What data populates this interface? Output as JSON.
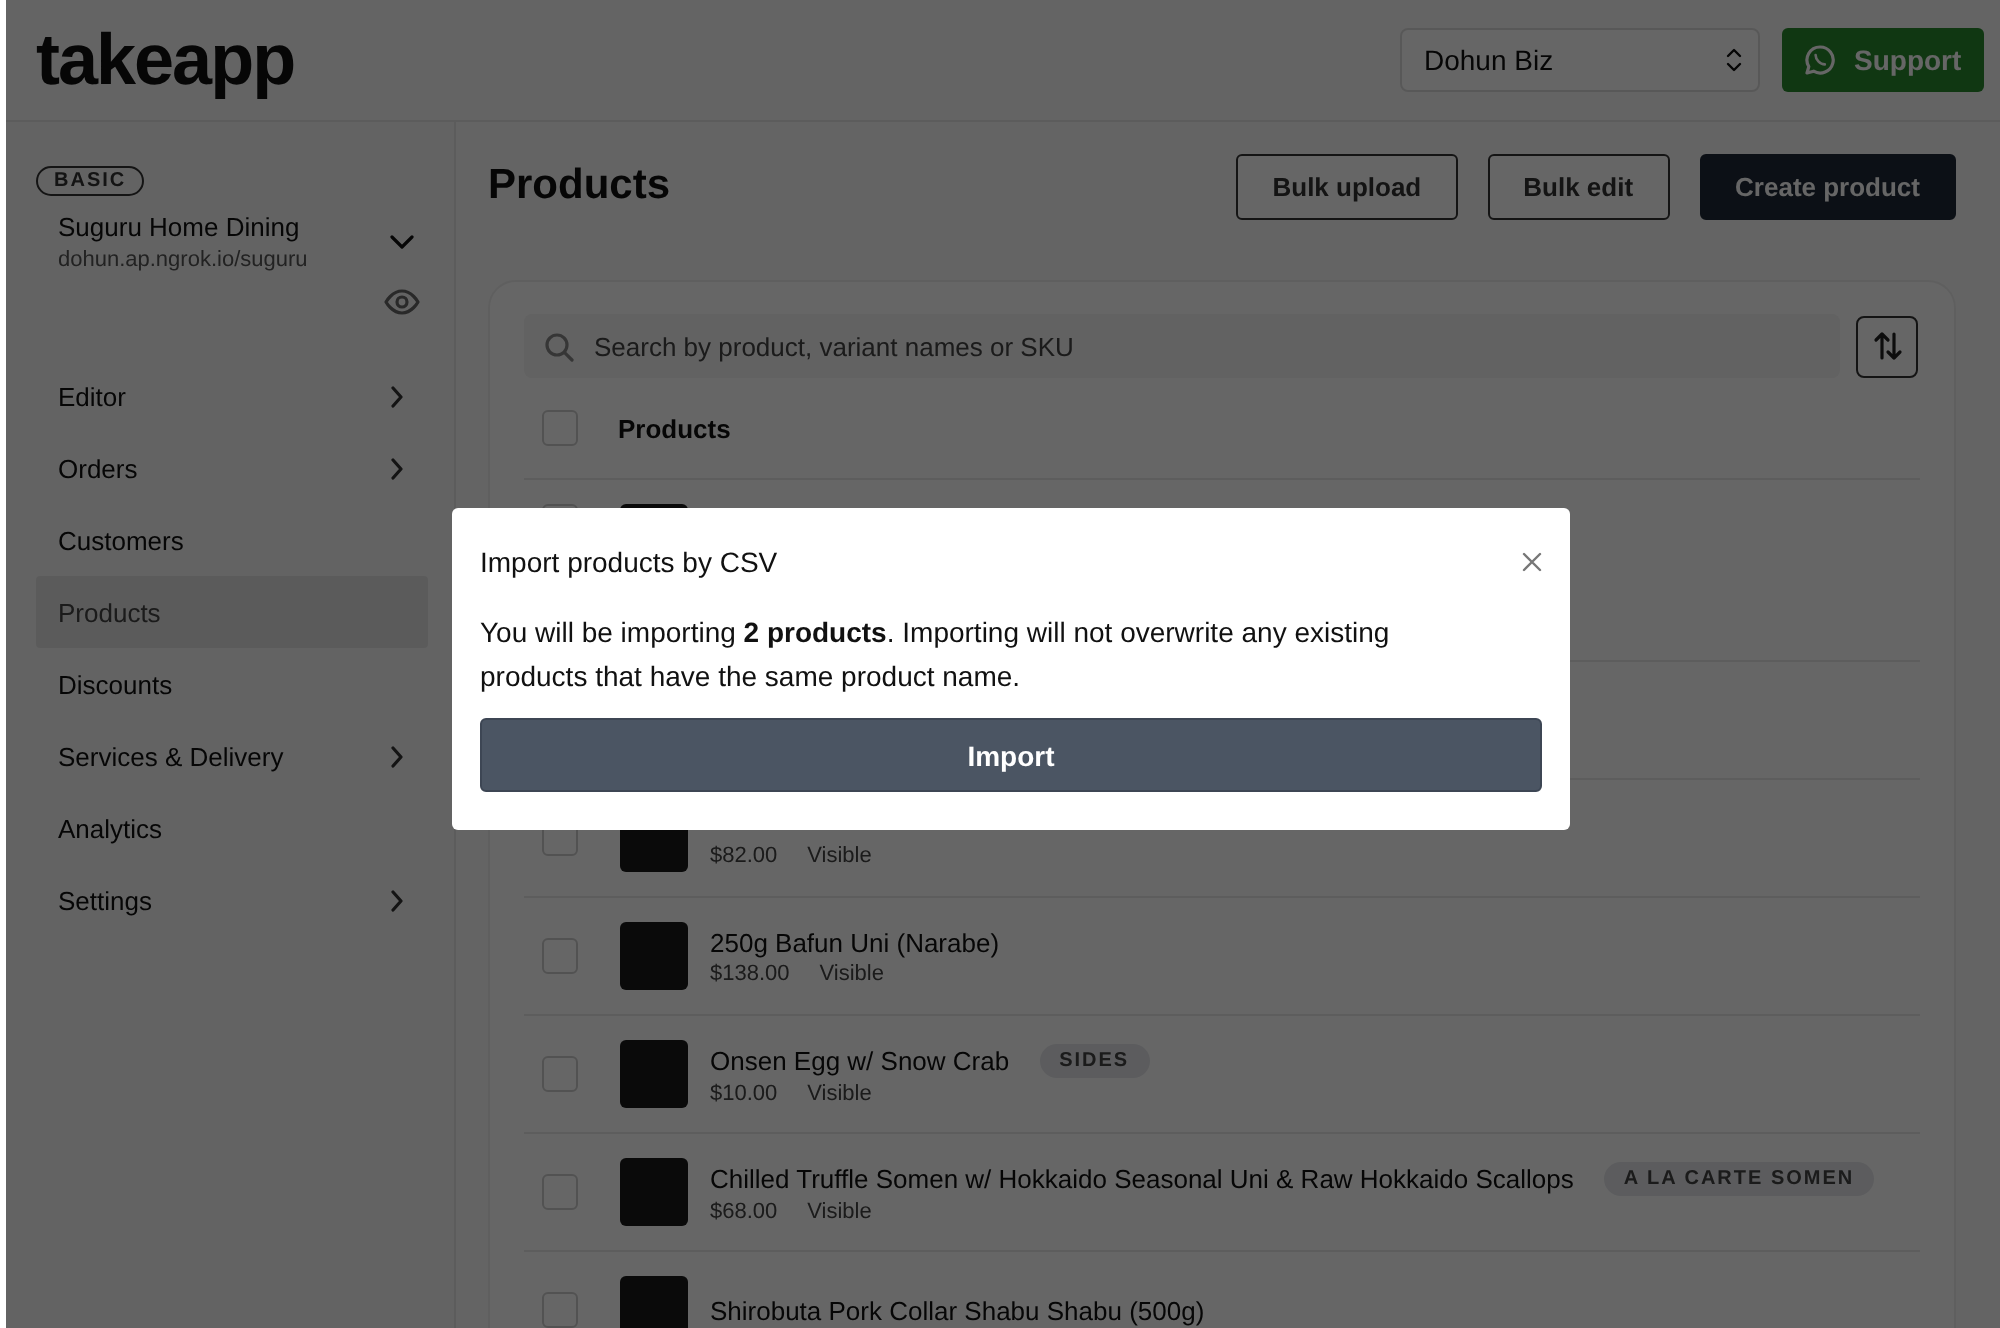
{
  "header": {
    "logo": "takeapp",
    "store_select": {
      "value": "Dohun Biz"
    },
    "support_button": "Support"
  },
  "sidebar": {
    "plan_badge": "BASIC",
    "store_name": "Suguru Home Dining",
    "store_url": "dohun.ap.ngrok.io/suguru",
    "items": [
      {
        "label": "Editor",
        "has_submenu": true,
        "selected": false
      },
      {
        "label": "Orders",
        "has_submenu": true,
        "selected": false
      },
      {
        "label": "Customers",
        "has_submenu": false,
        "selected": false
      },
      {
        "label": "Products",
        "has_submenu": false,
        "selected": true
      },
      {
        "label": "Discounts",
        "has_submenu": false,
        "selected": false
      },
      {
        "label": "Services & Delivery",
        "has_submenu": true,
        "selected": false
      },
      {
        "label": "Analytics",
        "has_submenu": false,
        "selected": false
      },
      {
        "label": "Settings",
        "has_submenu": true,
        "selected": false
      }
    ]
  },
  "page": {
    "title": "Products",
    "buttons": [
      {
        "label": "Bulk upload",
        "kind": "outline"
      },
      {
        "label": "Bulk edit",
        "kind": "outline"
      },
      {
        "label": "Create product",
        "kind": "primary"
      }
    ],
    "search": {
      "placeholder": "Search by product, variant names or SKU"
    },
    "table": {
      "column": "Products",
      "all_checked": false,
      "rows": [
        {
          "kind": "tall",
          "checked": false
        },
        {
          "kind": "normal"
        },
        {
          "kind": "normal",
          "checked": false,
          "price": "$82.00",
          "visibility": "Visible"
        },
        {
          "kind": "normal",
          "checked": false,
          "name": "250g Bafun Uni (Narabe)",
          "price": "$138.00",
          "visibility": "Visible"
        },
        {
          "kind": "normal",
          "checked": false,
          "name": "Onsen Egg w/ Snow Crab",
          "tag": "SIDES",
          "price": "$10.00",
          "visibility": "Visible"
        },
        {
          "kind": "normal",
          "checked": false,
          "name": "Chilled Truffle Somen w/ Hokkaido Seasonal Uni & Raw Hokkaido Scallops",
          "tag": "A LA CARTE SOMEN",
          "price": "$68.00",
          "visibility": "Visible"
        },
        {
          "kind": "normal",
          "checked": false,
          "name": "Shirobuta Pork Collar Shabu Shabu (500g)"
        }
      ]
    }
  },
  "modal": {
    "title": "Import products by CSV",
    "message": "You will be importing **2 products**. Importing will not overwrite any existing products that have the same product name.",
    "button": "Import"
  }
}
